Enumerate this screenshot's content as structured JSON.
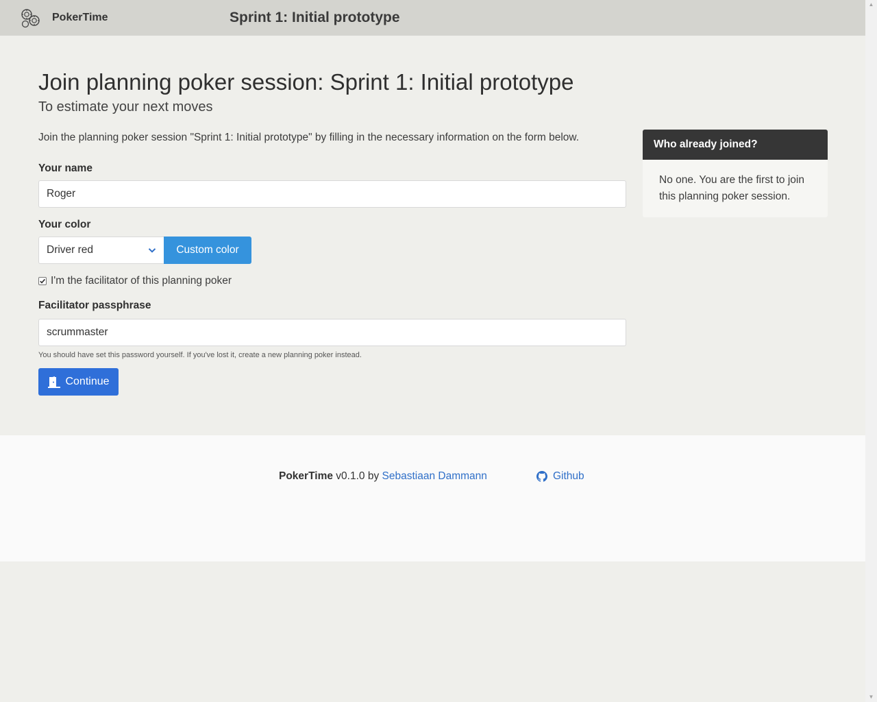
{
  "navbar": {
    "brand_icon": "poker-chips-icon",
    "brand_name": "PokerTime",
    "session_title": "Sprint 1: Initial prototype"
  },
  "header": {
    "title": "Join planning poker session: Sprint 1: Initial prototype",
    "subtitle": "To estimate your next moves"
  },
  "form": {
    "intro": "Join the planning poker session \"Sprint 1: Initial prototype\" by filling in the necessary information on the form below.",
    "name_label": "Your name",
    "name_value": "Roger",
    "color_label": "Your color",
    "color_selected": "Driver red",
    "custom_color_label": "Custom color",
    "facilitator_checked": true,
    "facilitator_label": "I'm the facilitator of this planning poker",
    "passphrase_label": "Facilitator passphrase",
    "passphrase_value": "scrummaster",
    "passphrase_help": "You should have set this password yourself. If you've lost it, create a new planning poker instead.",
    "continue_label": "Continue",
    "continue_icon": "door-open-icon"
  },
  "panel": {
    "title": "Who already joined?",
    "body": "No one. You are the first to join this planning poker session."
  },
  "footer": {
    "app_name": "PokerTime",
    "version_text": "v0.1.0 by",
    "author": "Sebastiaan Dammann",
    "github_label": "Github",
    "github_icon": "github-icon"
  },
  "colors": {
    "navbar_bg": "#d4d4cf",
    "page_bg": "#efefeb",
    "custom_color_button": "#3593dd",
    "continue_button": "#2f6fd9",
    "panel_header": "#363636",
    "link": "#2f6fc8"
  }
}
